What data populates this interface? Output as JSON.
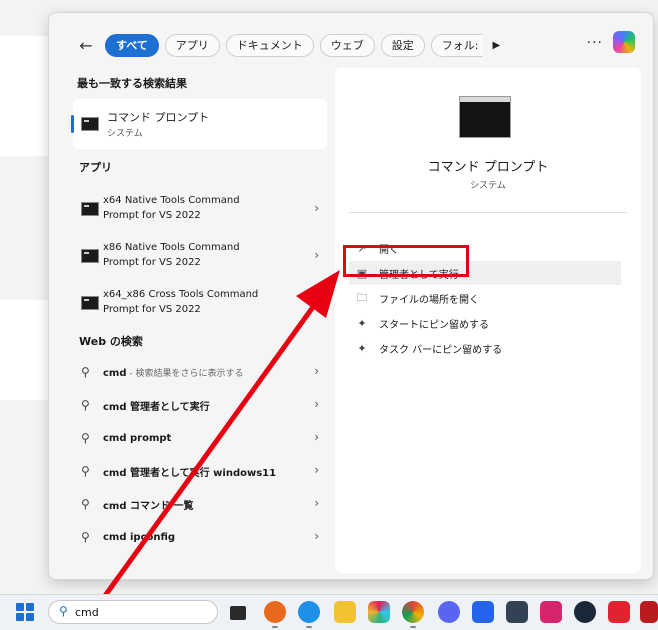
{
  "filters": {
    "all": "すべて",
    "apps": "アプリ",
    "documents": "ドキュメント",
    "web": "ウェブ",
    "settings": "設定",
    "folders": "フォル:"
  },
  "best_match": {
    "heading": "最も一致する検索結果",
    "title": "コマンド プロンプト",
    "subtitle": "システム"
  },
  "apps": {
    "heading": "アプリ",
    "items": [
      {
        "line1": "x64 Native Tools Command",
        "line2": "Prompt for VS 2022"
      },
      {
        "line1": "x86 Native Tools Command",
        "line2": "Prompt for VS 2022"
      },
      {
        "line1": "x64_x86 Cross Tools Command",
        "line2": "Prompt for VS 2022"
      }
    ]
  },
  "web_search": {
    "heading": "Web の検索",
    "items": [
      {
        "query": "cmd",
        "suffix": " - 検索結果をさらに表示する"
      },
      {
        "query": "cmd 管理者として実行",
        "suffix": ""
      },
      {
        "query": "cmd prompt",
        "suffix": ""
      },
      {
        "query": "cmd 管理者として実行 windows11",
        "suffix": ""
      },
      {
        "query": "cmd コマンド 一覧",
        "suffix": ""
      },
      {
        "query": "cmd ipconfig",
        "suffix": ""
      }
    ]
  },
  "preview": {
    "title": "コマンド プロンプト",
    "subtitle": "システム",
    "actions": {
      "open": "開く",
      "run_as_admin": "管理者として実行",
      "open_file_location": "ファイルの場所を開く",
      "pin_start": "スタートにピン留めする",
      "pin_taskbar": "タスク バーにピン留めする"
    }
  },
  "taskbar": {
    "search_value": "cmd"
  },
  "colors": {
    "accent": "#1d6fd1",
    "highlight": "#e60012"
  }
}
